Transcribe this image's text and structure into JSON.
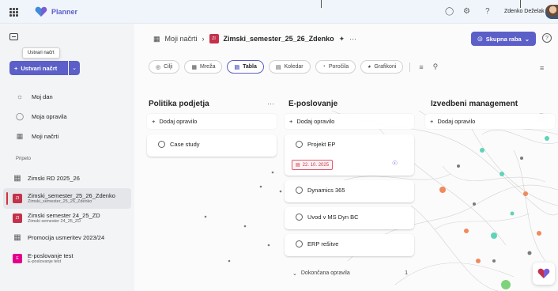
{
  "topbar": {
    "app_name": "Planner",
    "user_name": "Zdenko Deželak",
    "icons": [
      "waffle-icon",
      "planner-logo-icon",
      "share-people-icon",
      "settings-icon",
      "help-icon",
      "avatar"
    ]
  },
  "sidebar": {
    "toggle_icon": "sidebar-toggle-icon",
    "tooltip": "Ustvari načrt",
    "create_label": "Ustvari načrt",
    "nav": [
      {
        "label": "Moj dan",
        "icon": "sun-icon"
      },
      {
        "label": "Moja opravila",
        "icon": "check-circle-icon"
      },
      {
        "label": "Moji načrti",
        "icon": "grid-icon"
      }
    ],
    "section_pinned": "Pripeto",
    "plans": [
      {
        "title": "Zimski RD 2025_26",
        "subtitle": "",
        "icon": "plan-grid-icon"
      },
      {
        "title": "Zimski_semester_25_26_Zdenko",
        "subtitle": "Zimski_semester_25_26_Zdenko",
        "badge": "ZI"
      },
      {
        "title": "Zimski semester 24_25_ZD",
        "subtitle": "Zimski semester 24_25_ZD",
        "badge": "ZI"
      },
      {
        "title": "Promocija usmeritev 2023/24",
        "subtitle": "",
        "icon": "plan-grid-icon"
      },
      {
        "title": "E-poslovanje test",
        "subtitle": "E-poslovanje test",
        "badge": "E"
      }
    ]
  },
  "header": {
    "breadcrumb_root": "Moji načrti",
    "plan_badge": "ZI",
    "plan_name": "Zimski_semester_25_26_Zdenko",
    "share_label": "Skupna raba",
    "views": [
      {
        "label": "Cilji",
        "icon": "goal-icon"
      },
      {
        "label": "Mreža",
        "icon": "grid-icon"
      },
      {
        "label": "Tabla",
        "icon": "board-icon",
        "active": true
      },
      {
        "label": "Koledar",
        "icon": "calendar-icon"
      },
      {
        "label": "Poročila",
        "icon": "chart-icon"
      },
      {
        "label": "Grafikoni",
        "icon": "pie-icon"
      }
    ]
  },
  "board": {
    "add_task_label": "Dodaj opravilo",
    "buckets": [
      {
        "title": "Politika podjetja",
        "tasks": [
          "Case study"
        ]
      },
      {
        "title": "E-poslovanje",
        "tasks": [
          "Projekt EP",
          "Dynamics 365",
          "Uvod v MS Dyn BC",
          "ERP rešitve"
        ],
        "due_date": "22. 10. 2025",
        "completed_label": "Dokončana opravila",
        "completed_count": "1"
      },
      {
        "title": "Izvedbeni management",
        "tasks": []
      }
    ]
  }
}
